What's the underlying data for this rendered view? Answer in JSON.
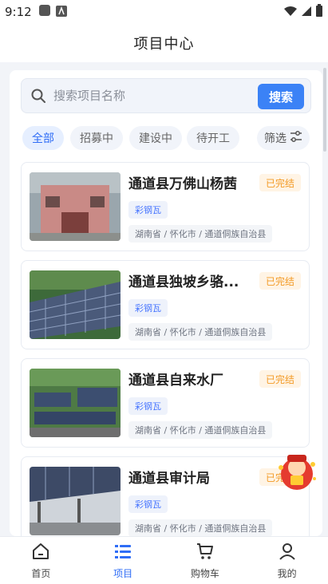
{
  "status_bar": {
    "time": "9:12"
  },
  "header": {
    "title": "项目中心"
  },
  "search": {
    "placeholder": "搜索项目名称",
    "button_label": "搜索"
  },
  "filters": {
    "chips": [
      "全部",
      "招募中",
      "建设中",
      "待开工"
    ],
    "active_index": 0,
    "filter_label": "筛选"
  },
  "projects": [
    {
      "title": "通道县万佛山杨茜",
      "status": "已完结",
      "tag": "彩钢瓦",
      "location": "湖南省 / 怀化市 / 通道侗族自治县"
    },
    {
      "title": "通道县独坡乡骆...",
      "status": "已完结",
      "tag": "彩钢瓦",
      "location": "湖南省 / 怀化市 / 通道侗族自治县"
    },
    {
      "title": "通道县自来水厂",
      "status": "已完结",
      "tag": "彩钢瓦",
      "location": "湖南省 / 怀化市 / 通道侗族自治县"
    },
    {
      "title": "通道县审计局",
      "status": "已完结",
      "tag": "彩钢瓦",
      "location": "湖南省 / 怀化市 / 通道侗族自治县"
    }
  ],
  "tab_bar": {
    "items": [
      {
        "label": "首页",
        "icon": "home-icon"
      },
      {
        "label": "项目",
        "icon": "list-icon"
      },
      {
        "label": "购物车",
        "icon": "cart-icon"
      },
      {
        "label": "我的",
        "icon": "user-icon"
      }
    ],
    "active_index": 1
  },
  "colors": {
    "accent": "#3b82f6",
    "status": "#f39a25",
    "tag": "#4775ff"
  }
}
